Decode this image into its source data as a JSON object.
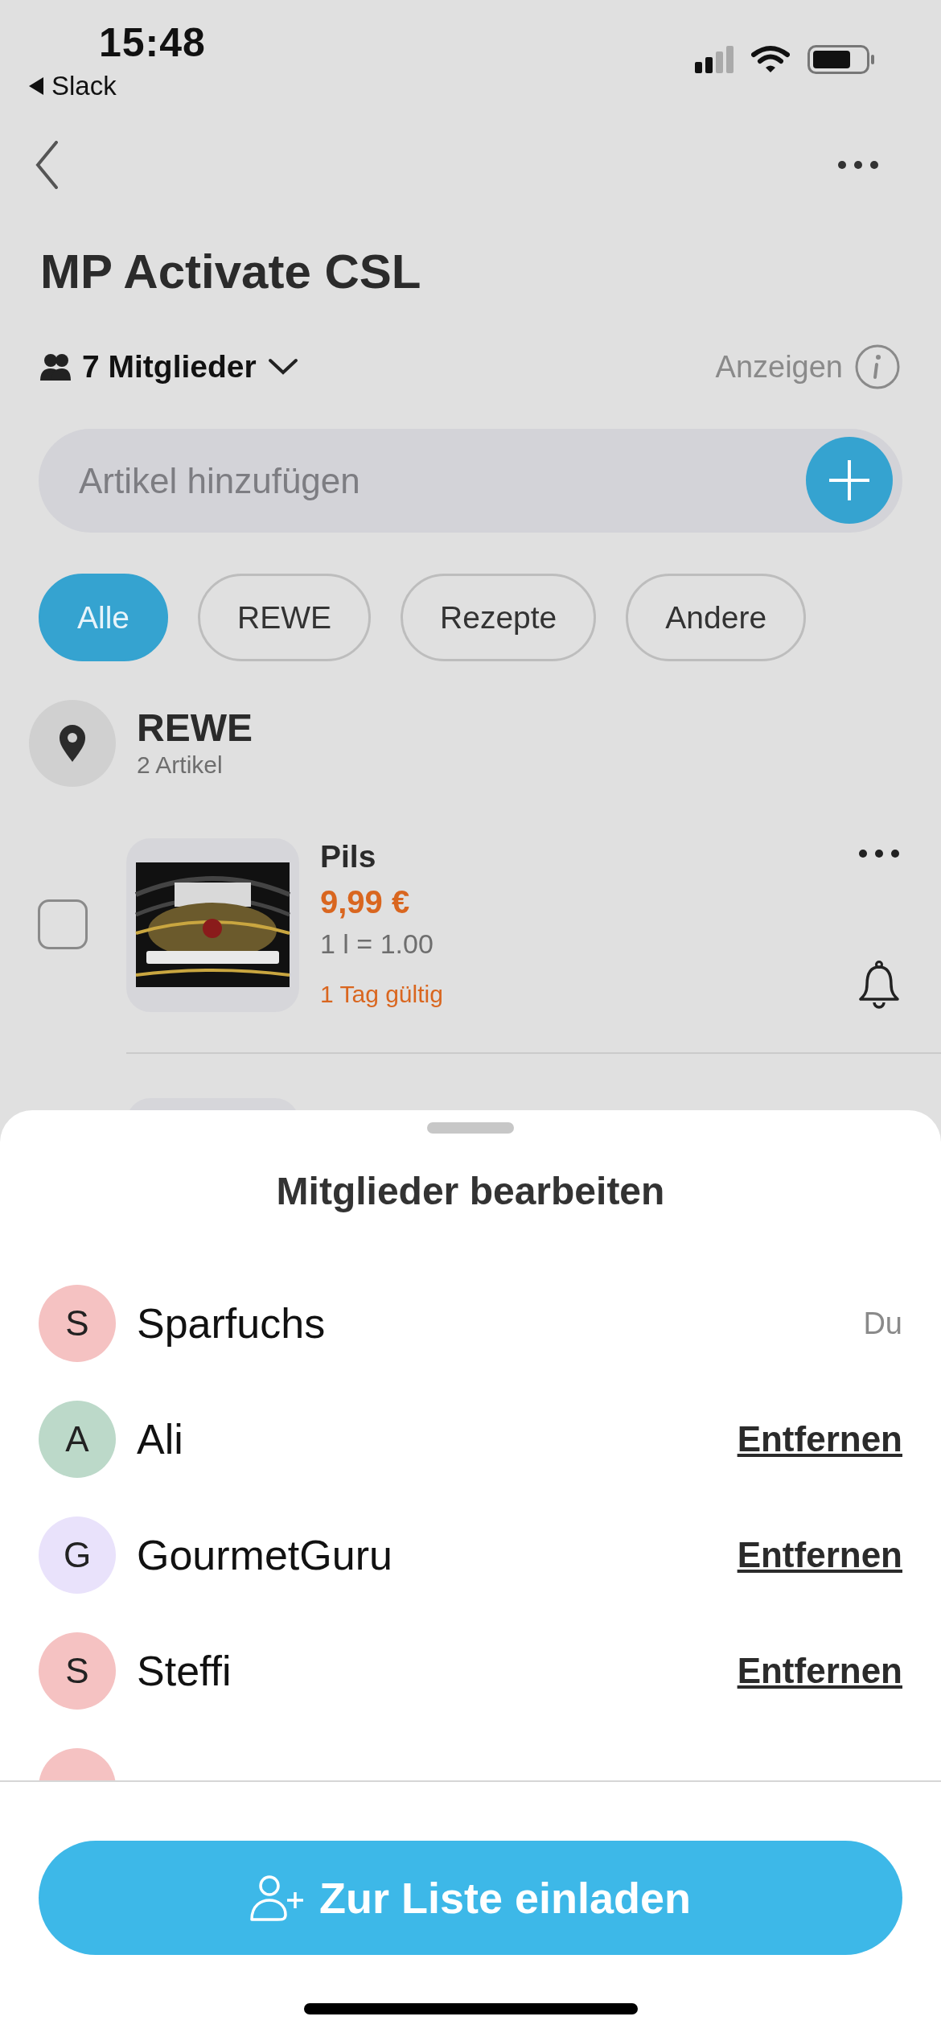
{
  "status_bar": {
    "time": "15:48",
    "back_app": "Slack"
  },
  "list": {
    "title": "MP Activate CSL",
    "members_label": "7 Mitglieder",
    "info_label": "Anzeigen"
  },
  "add_field": {
    "placeholder": "Artikel hinzufügen"
  },
  "filters": [
    {
      "label": "Alle",
      "selected": true
    },
    {
      "label": "REWE",
      "selected": false
    },
    {
      "label": "Rezepte",
      "selected": false
    },
    {
      "label": "Andere",
      "selected": false
    }
  ],
  "store": {
    "name": "REWE",
    "count": "2 Artikel"
  },
  "items": [
    {
      "kind": "full",
      "name": "Pils",
      "price": "9,99 €",
      "unit_price": "1 l = 1.00",
      "validity": "1 Tag gültig",
      "checked": false
    },
    {
      "kind": "partial"
    }
  ],
  "sheet": {
    "title": "Mitglieder bearbeiten",
    "members": [
      {
        "initial": "S",
        "name": "Sparfuchs",
        "color": "#f5c2c2",
        "kind": "self",
        "action": "Du"
      },
      {
        "initial": "A",
        "name": "Ali",
        "color": "#bcd9c9",
        "kind": "removable",
        "action": "Entfernen"
      },
      {
        "initial": "G",
        "name": "GourmetGuru",
        "color": "#e9e2fb",
        "kind": "removable",
        "action": "Entfernen"
      },
      {
        "initial": "S",
        "name": "Steffi",
        "color": "#f5c2c2",
        "kind": "removable",
        "action": "Entfernen"
      },
      {
        "color": "#f5c2c2",
        "kind": "partial"
      }
    ],
    "invite_button": "Zur Liste einladen"
  }
}
